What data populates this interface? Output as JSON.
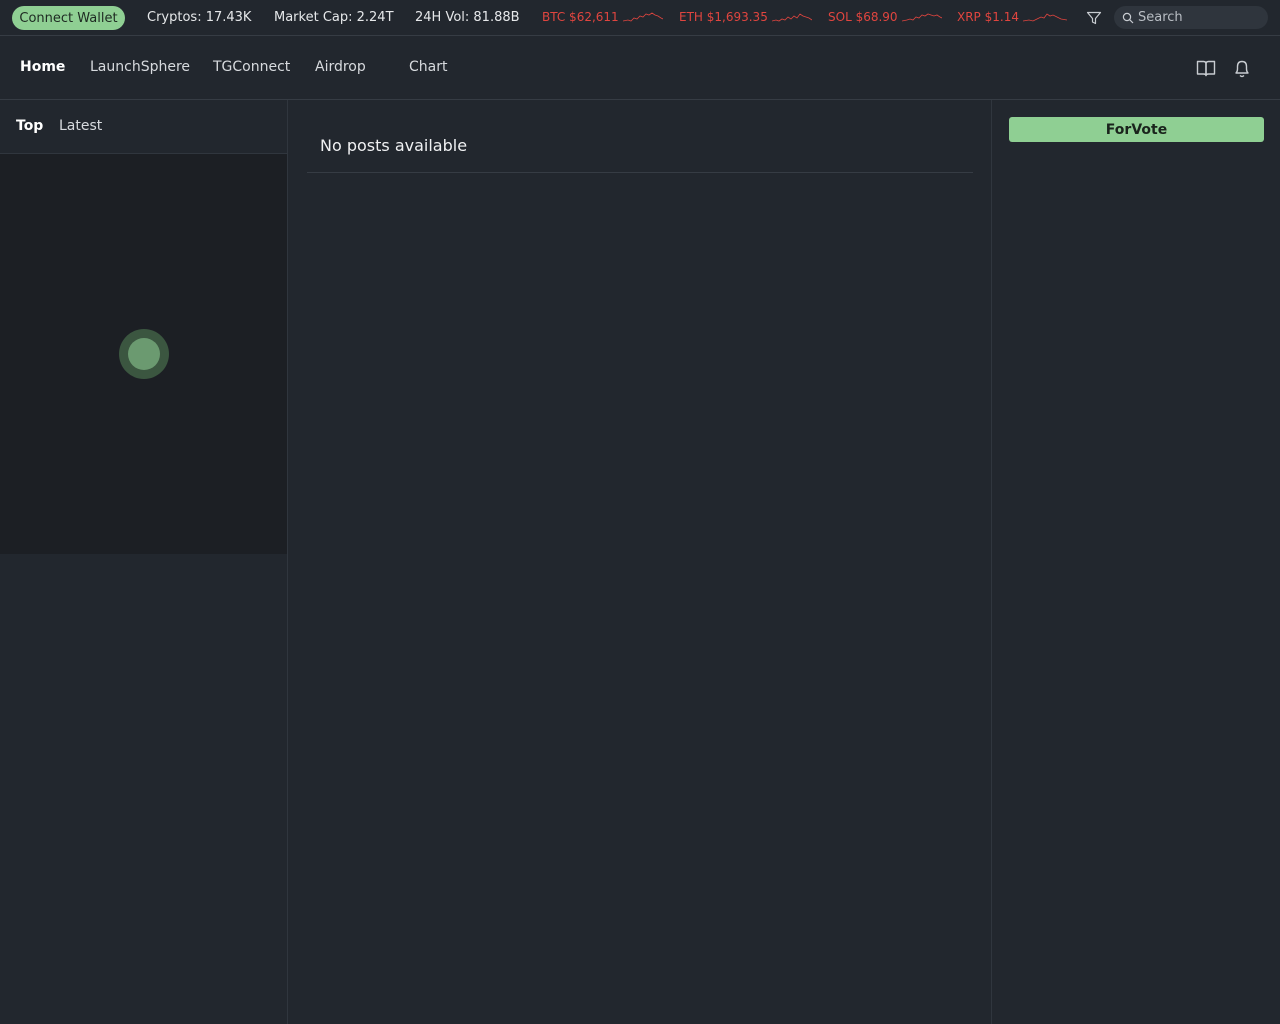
{
  "ticker": {
    "connect_wallet": "Connect Wallet",
    "cryptos": "Cryptos: 17.43K",
    "market_cap": "Market Cap: 2.24T",
    "volume": "24H Vol: 81.88B",
    "coins": [
      {
        "label": "BTC $62,611"
      },
      {
        "label": "ETH $1,693.35"
      },
      {
        "label": "SOL $68.90"
      },
      {
        "label": "XRP $1.14"
      }
    ],
    "search_placeholder": "Search",
    "down_color": "#e0453f"
  },
  "nav": {
    "items": [
      {
        "label": "Home",
        "active": true
      },
      {
        "label": "LaunchSphere"
      },
      {
        "label": "TGConnect"
      },
      {
        "label": "Airdrop"
      },
      {
        "label": "Chart"
      }
    ],
    "icons": [
      "book-icon",
      "bell-icon"
    ]
  },
  "feed": {
    "tabs": [
      {
        "label": "Top",
        "active": true
      },
      {
        "label": "Latest"
      }
    ]
  },
  "main": {
    "empty_message": "No posts available"
  },
  "sidebar": {
    "vote_button": "ForVote",
    "accent": "#8fcf93"
  }
}
